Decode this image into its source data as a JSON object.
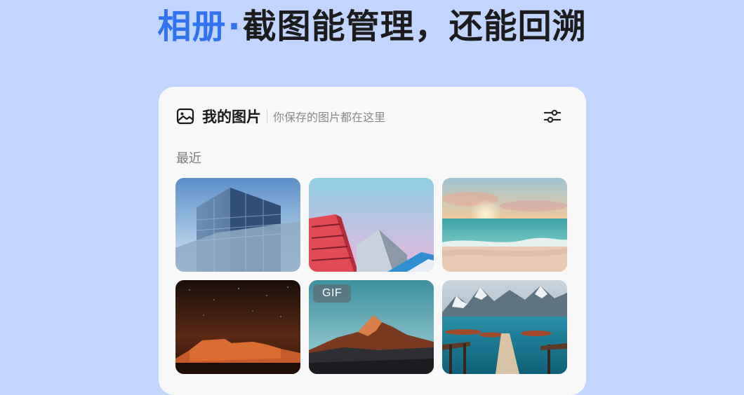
{
  "headline": {
    "accent": "相册",
    "separator": "·",
    "rest": "截图能管理，还能回溯"
  },
  "card": {
    "title": "我的图片",
    "subtitle": "你保存的图片都在这里",
    "section_label": "最近",
    "photos": [
      {
        "name": "glass-building-photo"
      },
      {
        "name": "colorful-buildings-photo"
      },
      {
        "name": "beach-sunset-photo"
      },
      {
        "name": "night-rock-photo"
      },
      {
        "name": "mountain-sunset-photo",
        "badge": "GIF"
      },
      {
        "name": "lake-pier-photo"
      }
    ]
  },
  "colors": {
    "background": "#c2d5ff",
    "accent": "#2f73f0",
    "card": "#f8f8f8"
  },
  "icons": {
    "header_icon": "image-icon",
    "filter_icon": "sliders-icon"
  }
}
